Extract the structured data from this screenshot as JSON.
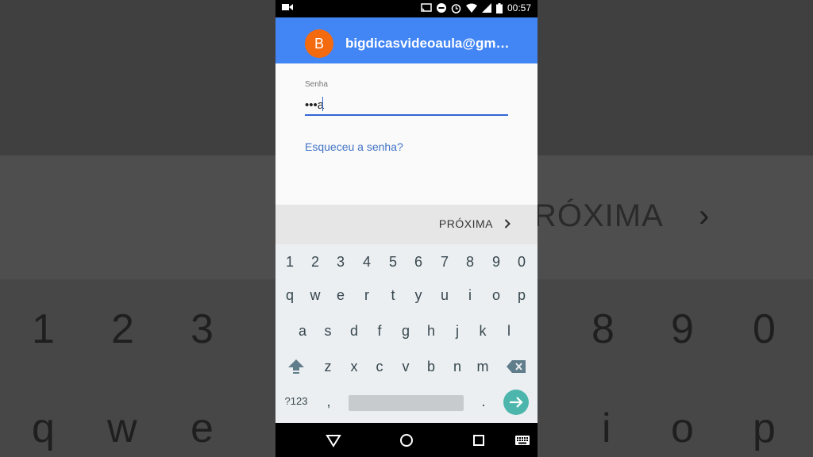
{
  "status_bar": {
    "time": "00:57",
    "left_icon": "video-camera-icon",
    "right_icons": [
      "cast-icon",
      "do-not-disturb-icon",
      "alarm-icon",
      "wifi-icon",
      "signal-icon",
      "battery-icon"
    ]
  },
  "account": {
    "avatar_letter": "B",
    "email": "bigdicasvideoaula@gm…",
    "avatar_color": "#f46a0f",
    "header_color": "#4285f4"
  },
  "password": {
    "label": "Senha",
    "value": "•••a"
  },
  "forgot_link": "Esqueceu a senha?",
  "next_button": {
    "label": "PRÓXIMA"
  },
  "keyboard": {
    "numbers": [
      "1",
      "2",
      "3",
      "4",
      "5",
      "6",
      "7",
      "8",
      "9",
      "0"
    ],
    "row1": [
      "q",
      "w",
      "e",
      "r",
      "t",
      "y",
      "u",
      "i",
      "o",
      "p"
    ],
    "row2": [
      "a",
      "s",
      "d",
      "f",
      "g",
      "h",
      "j",
      "k",
      "l"
    ],
    "row3": [
      "z",
      "x",
      "c",
      "v",
      "b",
      "n",
      "m"
    ],
    "symbols_label": "?123",
    "comma": ",",
    "period": "."
  },
  "background": {
    "next_label": "RÓXIMA",
    "numbers_left": [
      "1",
      "2",
      "3"
    ],
    "numbers_right": [
      "8",
      "9",
      "0"
    ],
    "letters_left": [
      "q",
      "w",
      "e"
    ],
    "letters_right": [
      "i",
      "o",
      "p"
    ]
  },
  "nav_bar": {
    "icons": [
      "back-icon",
      "home-icon",
      "recents-icon",
      "keyboard-switch-icon"
    ]
  }
}
